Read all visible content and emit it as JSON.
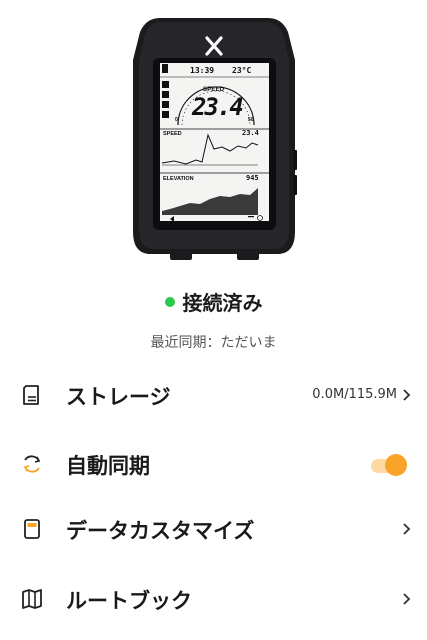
{
  "device": {
    "status_bar": {
      "time": "13:39",
      "temperature": "23°C"
    },
    "speed_label": "SPEED",
    "speed_value": "23.4",
    "scale_min": "0",
    "scale_max": "50",
    "speed_field_label": "SPEED",
    "speed_field_value": "23.4",
    "elevation_field_label": "ELEVATION",
    "elevation_field_value": "945"
  },
  "connection": {
    "status": "接続済み",
    "status_color": "#2cc84d",
    "last_sync": "最近同期：ただいま"
  },
  "menu": {
    "storage": {
      "label": "ストレージ",
      "value": "0.0M/115.9M"
    },
    "auto_sync": {
      "label": "自動同期",
      "enabled": true,
      "accent": "#f7a428"
    },
    "data_customize": {
      "label": "データカスタマイズ"
    },
    "route_book": {
      "label": "ルートブック"
    }
  }
}
